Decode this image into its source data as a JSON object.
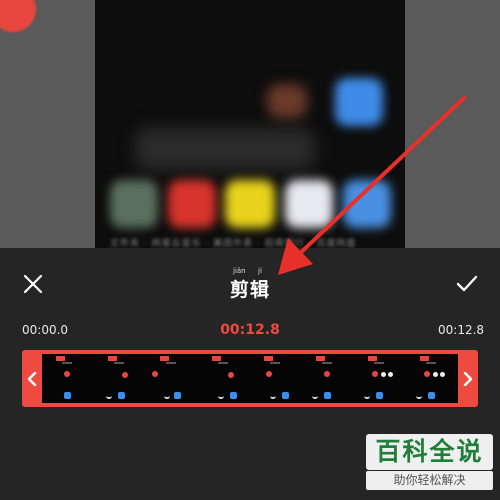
{
  "preview": {
    "dock_labels": "文件夹 · 网易云音乐 · 美团外卖 · 招商银行 · 百度网盘"
  },
  "editor": {
    "title": "剪辑",
    "title_pinyin": [
      "jiǎn",
      "jí"
    ],
    "time_start": "00:00.0",
    "time_current": "00:12.8",
    "time_end": "00:12.8",
    "close_icon": "close-icon",
    "confirm_icon": "check-icon",
    "frames_count_label": "",
    "accent_color": "#ef4a3f"
  },
  "watermark": {
    "main": "百科全说",
    "sub": "助你轻松解决"
  }
}
